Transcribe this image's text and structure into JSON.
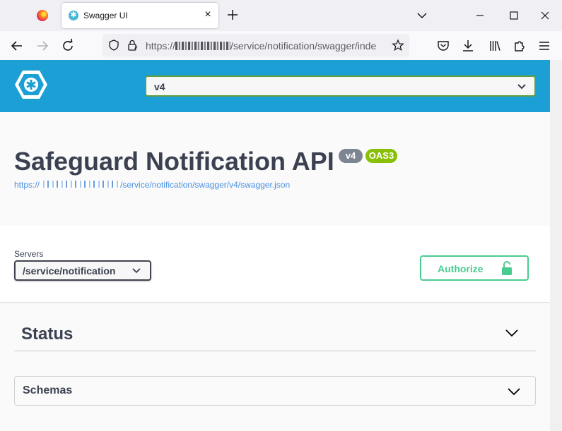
{
  "browser": {
    "tab_title": "Swagger UI",
    "tab_close_glyph": "×",
    "new_tab_glyph": "+",
    "url_prefix": "https://",
    "url_suffix": "/service/notification/swagger/inde",
    "icons": [
      "firefox-logo",
      "swagger-favicon",
      "back-arrow",
      "forward-arrow",
      "reload",
      "shield",
      "lock",
      "bookmark-star",
      "pocket",
      "download",
      "library",
      "extensions",
      "menu-hamburger"
    ]
  },
  "swagger": {
    "spec_selected": "v4",
    "title": "Safeguard Notification API",
    "version_badge": "v4",
    "oas_badge": "OAS3",
    "spec_link_prefix": "https://",
    "spec_link_suffix": "/service/notification/swagger/v4/swagger.json",
    "servers_label": "Servers",
    "servers_selected": "/service/notification",
    "authorize_label": "Authorize",
    "sections": [
      {
        "title": "Status"
      }
    ],
    "schemas_title": "Schemas"
  },
  "colors": {
    "topbar": "#1b9fd4",
    "select_border": "#62a03f",
    "authorize": "#49cc90",
    "oas_badge": "#89bf04",
    "version_badge": "#7d8492",
    "text": "#3b4151",
    "link": "#4990e2"
  }
}
